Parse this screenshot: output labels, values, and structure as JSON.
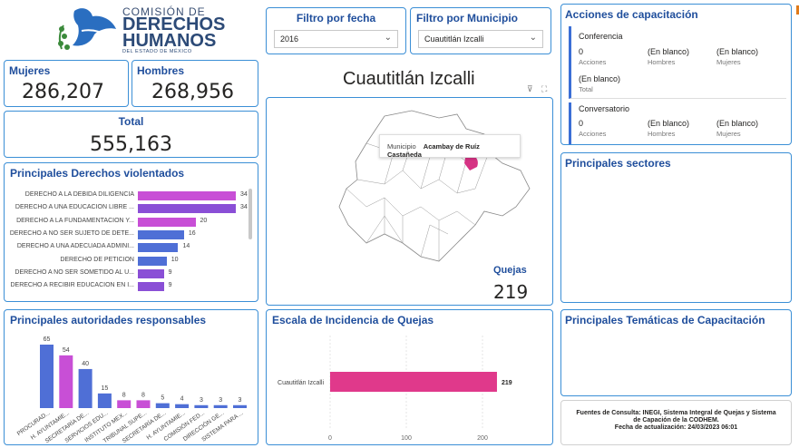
{
  "logo": {
    "line1": "COMISIÓN DE",
    "line2a": "DERECHOS",
    "line2b": "HUMANOS",
    "line3": "DEL ESTADO DE MÉXICO"
  },
  "kpi": {
    "mujeres_label": "Mujeres",
    "mujeres_value": "286,207",
    "hombres_label": "Hombres",
    "hombres_value": "268,956",
    "total_label": "Total",
    "total_value": "555,163"
  },
  "filters": {
    "fecha_title": "Filtro por fecha",
    "fecha_value": "2016",
    "municipio_title": "Filtro por Municipio",
    "municipio_value": "Cuautitlán Izcalli"
  },
  "map": {
    "title": "Cuautitlán Izcalli",
    "tooltip_key": "Municipio",
    "tooltip_value": "Acambay de Ruíz Castañeda",
    "quejas_label": "Quejas",
    "quejas_value": "219"
  },
  "derechos": {
    "title": "Principales Derechos violentados",
    "items": [
      {
        "label": "DERECHO A LA DEBIDA DILIGENCIA",
        "value": 34,
        "color": "#c84fd6"
      },
      {
        "label": "DERECHO A UNA EDUCACIÓN LIBRE ...",
        "value": 34,
        "color": "#8a4fd6"
      },
      {
        "label": "DERECHO A LA FUNDAMENTACIÓN Y...",
        "value": 20,
        "color": "#c84fd6"
      },
      {
        "label": "DERECHO A NO SER SUJETO DE DETE...",
        "value": 16,
        "color": "#4f6fd6"
      },
      {
        "label": "DERECHO A UNA ADECUADA ADMINI...",
        "value": 14,
        "color": "#4f6fd6"
      },
      {
        "label": "DERECHO DE PETICIÓN",
        "value": 10,
        "color": "#4f6fd6"
      },
      {
        "label": "DERECHO A NO SER SOMETIDO AL U...",
        "value": 9,
        "color": "#8a4fd6"
      },
      {
        "label": "DERECHO A RECIBIR EDUCACIÓN EN I...",
        "value": 9,
        "color": "#8a4fd6"
      }
    ]
  },
  "autoridades": {
    "title": "Principales autoridades responsables",
    "items": [
      {
        "label": "PROCURAD...",
        "value": 65,
        "color": "#4f6fd6"
      },
      {
        "label": "H. AYUNTAMIE...",
        "value": 54,
        "color": "#c84fd6"
      },
      {
        "label": "SECRETARÍA DE...",
        "value": 40,
        "color": "#4f6fd6"
      },
      {
        "label": "SERVICIOS EDU...",
        "value": 15,
        "color": "#4f6fd6"
      },
      {
        "label": "INSTITUTO MEX...",
        "value": 8,
        "color": "#c84fd6"
      },
      {
        "label": "TRIBUNAL SUPE...",
        "value": 8,
        "color": "#c84fd6"
      },
      {
        "label": "SECRETARÍA DE...",
        "value": 5,
        "color": "#4f6fd6"
      },
      {
        "label": "H. AYUNTAMIE...",
        "value": 4,
        "color": "#4f6fd6"
      },
      {
        "label": "COMISIÓN FED...",
        "value": 3,
        "color": "#4f6fd6"
      },
      {
        "label": "DIRECCIÓN GE...",
        "value": 3,
        "color": "#4f6fd6"
      },
      {
        "label": "SISTEMA PARA ...",
        "value": 3,
        "color": "#4f6fd6"
      }
    ]
  },
  "escala": {
    "title": "Escala de Incidencia de Quejas",
    "category": "Cuautitlán Izcalli",
    "value_label": "219",
    "ticks": [
      "0",
      "100",
      "200"
    ]
  },
  "acciones": {
    "title": "Acciones de capacitación",
    "groups": [
      {
        "name": "Conferencia",
        "c1_val": "0",
        "c1_lbl": "Acciones",
        "c2_val": "(En blanco)",
        "c2_lbl": "Hombres",
        "c3_val": "(En blanco)",
        "c3_lbl": "Mujeres",
        "total_val": "(En blanco)",
        "total_lbl": "Total"
      },
      {
        "name": "Conversatorio",
        "c1_val": "0",
        "c1_lbl": "Acciones",
        "c2_val": "(En blanco)",
        "c2_lbl": "Hombres",
        "c3_val": "(En blanco)",
        "c3_lbl": "Mujeres"
      }
    ]
  },
  "sectores": {
    "title": "Principales sectores"
  },
  "tematicas": {
    "title": "Principales Temáticas de Capacitación"
  },
  "fuentes": {
    "line1": "Fuentes de Consulta: INEGI, Sistema Integral de Quejas y Sistema",
    "line2": "de Capación de la CODHEM.",
    "line3": "Fecha de actualización: 24/03/2023 06:01"
  },
  "chart_data": [
    {
      "type": "bar",
      "title": "Principales Derechos violentados",
      "categories": [
        "DERECHO A LA DEBIDA DILIGENCIA",
        "DERECHO A UNA EDUCACIÓN LIBRE ...",
        "DERECHO A LA FUNDAMENTACIÓN Y...",
        "DERECHO A NO SER SUJETO DE DETE...",
        "DERECHO A UNA ADECUADA ADMINI...",
        "DERECHO DE PETICIÓN",
        "DERECHO A NO SER SOMETIDO AL U...",
        "DERECHO A RECIBIR EDUCACIÓN EN I..."
      ],
      "values": [
        34,
        34,
        20,
        16,
        14,
        10,
        9,
        9
      ],
      "orientation": "horizontal"
    },
    {
      "type": "bar",
      "title": "Principales autoridades responsables",
      "categories": [
        "PROCURAD...",
        "H. AYUNTAMIE...",
        "SECRETARÍA DE...",
        "SERVICIOS EDU...",
        "INSTITUTO MEX...",
        "TRIBUNAL SUPE...",
        "SECRETARÍA DE...",
        "H. AYUNTAMIE...",
        "COMISIÓN FED...",
        "DIRECCIÓN GE...",
        "SISTEMA PARA ..."
      ],
      "values": [
        65,
        54,
        40,
        15,
        8,
        8,
        5,
        4,
        3,
        3,
        3
      ],
      "orientation": "vertical"
    },
    {
      "type": "bar",
      "title": "Escala de Incidencia de Quejas",
      "categories": [
        "Cuautitlán Izcalli"
      ],
      "values": [
        219
      ],
      "xlim": [
        0,
        250
      ],
      "orientation": "horizontal"
    }
  ]
}
